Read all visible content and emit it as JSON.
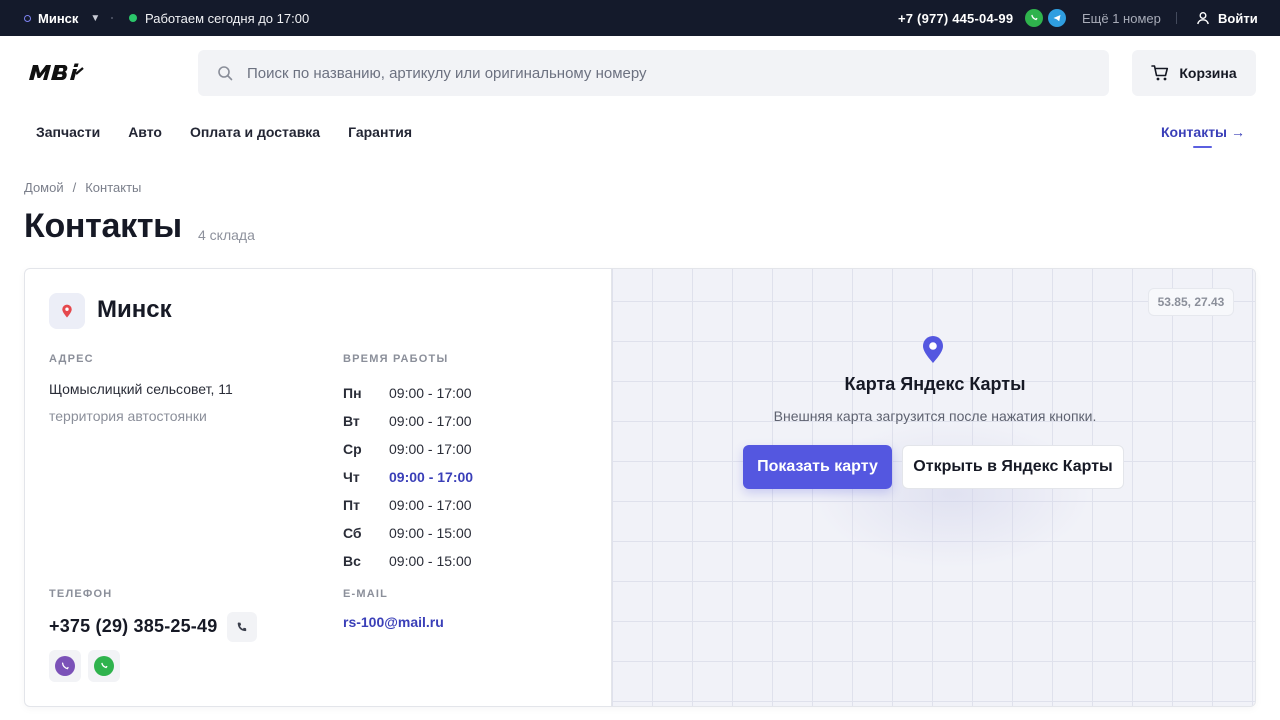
{
  "topbar": {
    "city": "Минск",
    "hours": "Работаем сегодня до 17:00",
    "phone": "+7 (977) 445-04-99",
    "more_numbers": "Ещё 1 номер",
    "login": "Войти"
  },
  "header": {
    "logo_text": "MBi",
    "search_placeholder": "Поиск по названию, артикулу или оригинальному номеру",
    "cart_label": "Корзина"
  },
  "nav": {
    "items": [
      "Запчасти",
      "Авто",
      "Оплата и доставка",
      "Гарантия"
    ],
    "active": "Контакты",
    "active_arrow": "→"
  },
  "breadcrumb": {
    "home": "Домой",
    "separator": "/",
    "current": "Контакты"
  },
  "page": {
    "title": "Контакты",
    "count": "4 склада"
  },
  "warehouse": {
    "city": "Минск",
    "address_label": "АДРЕС",
    "address_line": "Щомыслицкий сельсовет, 11",
    "address_note": "территория автостоянки",
    "hours_label": "ВРЕМЯ РАБОТЫ",
    "schedule": [
      {
        "day": "Пн",
        "time": "09:00 - 17:00"
      },
      {
        "day": "Вт",
        "time": "09:00 - 17:00"
      },
      {
        "day": "Ср",
        "time": "09:00 - 17:00"
      },
      {
        "day": "Чт",
        "time": "09:00 - 17:00"
      },
      {
        "day": "Пт",
        "time": "09:00 - 17:00"
      },
      {
        "day": "Сб",
        "time": "09:00 - 15:00"
      },
      {
        "day": "Вс",
        "time": "09:00 - 15:00"
      }
    ],
    "today_index": 3,
    "phone_label": "ТЕЛЕФОН",
    "phone": "+375 (29) 385-25-49",
    "email_label": "E-MAIL",
    "email": "rs-100@mail.ru"
  },
  "map": {
    "coords": "53.85, 27.43",
    "title": "Карта Яндекс Карты",
    "subtitle": "Внешняя карта загрузится после нажатия кнопки.",
    "show_button": "Показать карту",
    "open_button": "Открыть в Яндекс Карты"
  },
  "colors": {
    "accent": "#5457e0",
    "link": "#3a3fb8",
    "topbar_bg": "#141a2b",
    "online": "#2bc66a",
    "whatsapp": "#2fb34d",
    "telegram": "#2f9ee0",
    "viber": "#7b52b8"
  },
  "icons": [
    "location-ring-icon",
    "whatsapp-icon",
    "telegram-icon",
    "user-icon",
    "search-icon",
    "cart-icon",
    "map-pin-icon",
    "phone-icon",
    "viber-icon"
  ]
}
